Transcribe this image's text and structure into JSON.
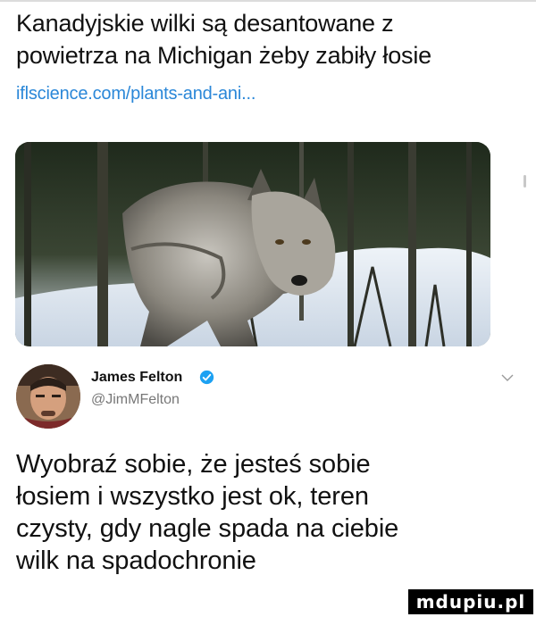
{
  "colors": {
    "link": "#2a87d8",
    "handle": "#777777",
    "verified": "#1da1f2",
    "watermark_bg": "#000000"
  },
  "headline": {
    "lines": [
      "Kanadyjskie wilki są desantowane z",
      "powietrza na Michigan żeby zabiły łosie"
    ]
  },
  "link": {
    "text": "iflscience.com/plants-and-ani..."
  },
  "media": {
    "subject": "wolf-in-snowy-forest"
  },
  "author": {
    "name": "James Felton",
    "handle": "@JimMFelton",
    "verified_icon": "verified-badge-icon",
    "menu_icon": "chevron-down-icon"
  },
  "tweet": {
    "lines": [
      "Wyobraź sobie, że jesteś sobie",
      "łosiem i wszystko jest ok, teren",
      "czysty, gdy nagle spada na ciebie",
      "wilk na spadochronie"
    ]
  },
  "watermark": {
    "text": "mdupiu.pl"
  }
}
